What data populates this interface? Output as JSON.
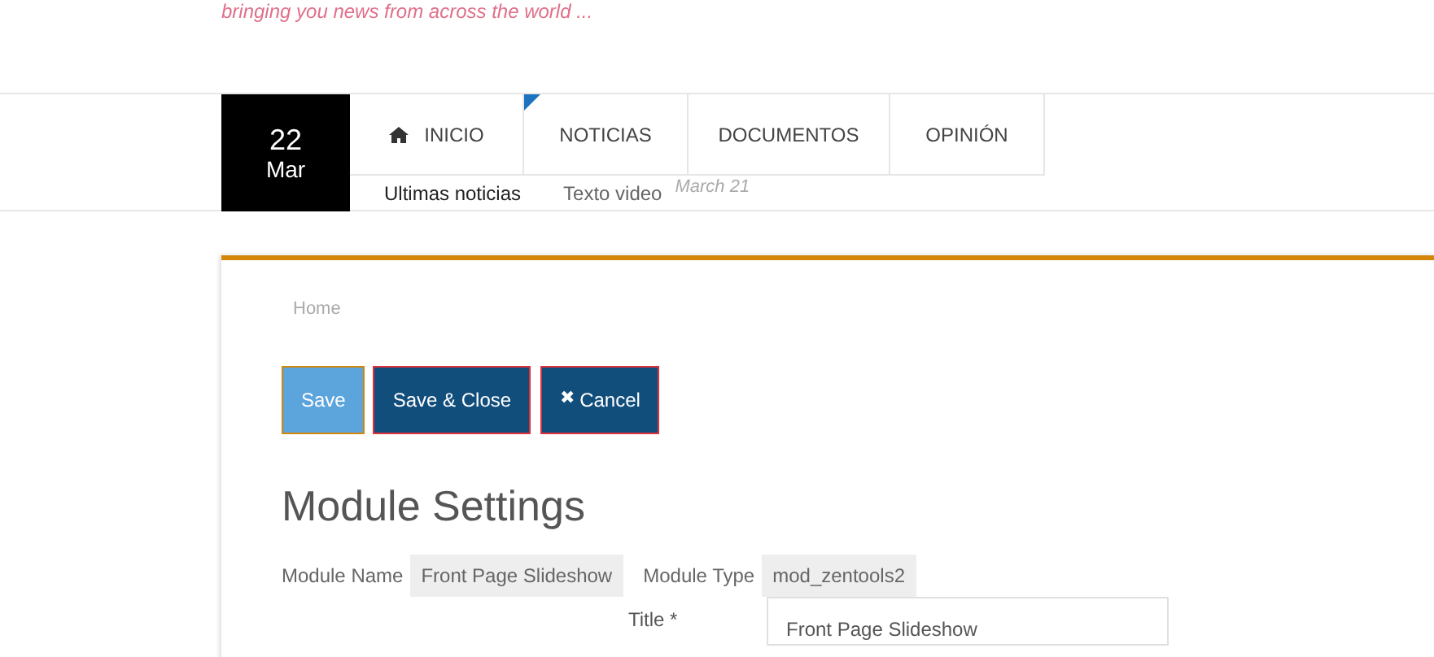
{
  "tagline": "bringing you news from across the world ...",
  "date": {
    "day": "22",
    "month": "Mar"
  },
  "menu": [
    {
      "label": "INICIO",
      "kind": "home"
    },
    {
      "label": "NOTICIAS",
      "kind": "marked"
    },
    {
      "label": "DOCUMENTOS",
      "kind": "plain"
    },
    {
      "label": "OPINIÓN",
      "kind": "plain"
    }
  ],
  "ticker": {
    "items": [
      "Ultimas noticias",
      "Texto video"
    ],
    "date": "March 21"
  },
  "breadcrumb": "Home",
  "buttons": [
    {
      "label": "Save",
      "kind": "light"
    },
    {
      "label": "Save & Close",
      "kind": "dark"
    },
    {
      "label": "Cancel",
      "kind": "dark",
      "icon": "✖"
    }
  ],
  "heading": "Module Settings",
  "module": {
    "name_label": "Module Name",
    "name": "Front Page Slideshow",
    "type_label": "Module Type",
    "type": "mod_zentools2"
  },
  "title_field": {
    "label": "Title *",
    "value": "Front Page Slideshow"
  }
}
